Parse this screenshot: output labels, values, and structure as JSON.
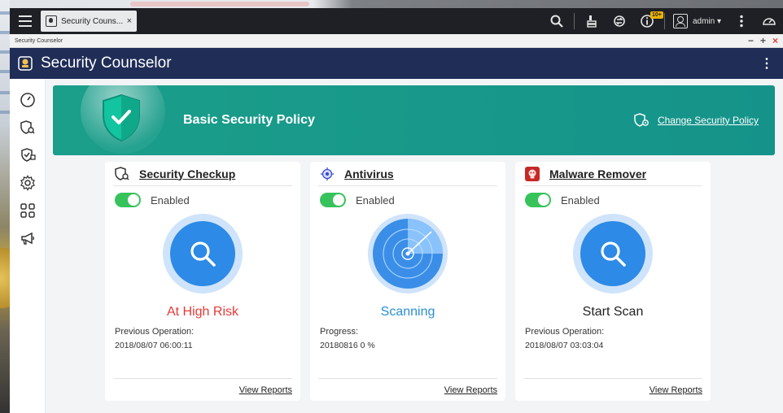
{
  "taskbar": {
    "tab_label": "Security Couns...",
    "tab_close": "×",
    "notification_badge": "10+",
    "user": "admin ▾"
  },
  "window": {
    "title": "Security Counselor",
    "controls": {
      "minimize": "−",
      "maximize": "+",
      "close": "×"
    }
  },
  "app": {
    "title": "Security Counselor",
    "more": "⋮"
  },
  "banner": {
    "title": "Basic Security Policy",
    "change_link": "Change Security Policy"
  },
  "cards": [
    {
      "title": "Security Checkup",
      "toggle_label": "Enabled",
      "status": "At High Risk",
      "meta_label": "Previous Operation:",
      "meta_value": "2018/08/07 06:00:11",
      "footer_link": "View Reports"
    },
    {
      "title": "Antivirus",
      "toggle_label": "Enabled",
      "status": "Scanning",
      "meta_label": "Progress:",
      "meta_value": "20180816 0 %",
      "footer_link": "View Reports"
    },
    {
      "title": "Malware Remover",
      "toggle_label": "Enabled",
      "status": "Start Scan",
      "meta_label": "Previous Operation:",
      "meta_value": "2018/08/07 03:03:04",
      "footer_link": "View Reports"
    }
  ],
  "colors": {
    "header_bg": "#1f2d57",
    "banner_bg": "#1b9e8a",
    "toggle_on": "#37c35c",
    "risk_red": "#e53935",
    "scan_blue": "#2a8fd4",
    "circle_blue": "#2d8ae6"
  },
  "icons": {
    "sidebar": [
      "dashboard-gauge-icon",
      "shield-scan-icon",
      "shield-check-icon",
      "gear-icon",
      "apps-grid-icon",
      "megaphone-icon"
    ]
  }
}
